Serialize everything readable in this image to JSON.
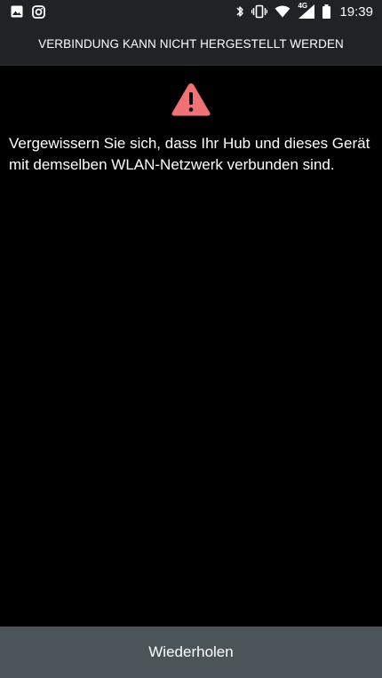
{
  "status_bar": {
    "left_icons": [
      "image-icon",
      "instagram-icon"
    ],
    "right_icons": [
      "bluetooth-icon",
      "vibrate-icon",
      "wifi-icon",
      "cell-signal-icon",
      "battery-icon"
    ],
    "network_type": "4G",
    "time": "19:39"
  },
  "header": {
    "title": "VERBINDUNG KANN NICHT HERGESTELLT WERDEN"
  },
  "main": {
    "icon": "warning-icon",
    "icon_color": "#f07176",
    "message": "Vergewissern Sie sich, dass Ihr Hub und dieses Gerät mit demselben WLAN-Netzwerk verbunden sind."
  },
  "footer": {
    "retry_label": "Wiederholen"
  },
  "colors": {
    "background": "#000000",
    "bars": "#1f2326",
    "button": "#4a5459",
    "text": "#ffffff"
  }
}
